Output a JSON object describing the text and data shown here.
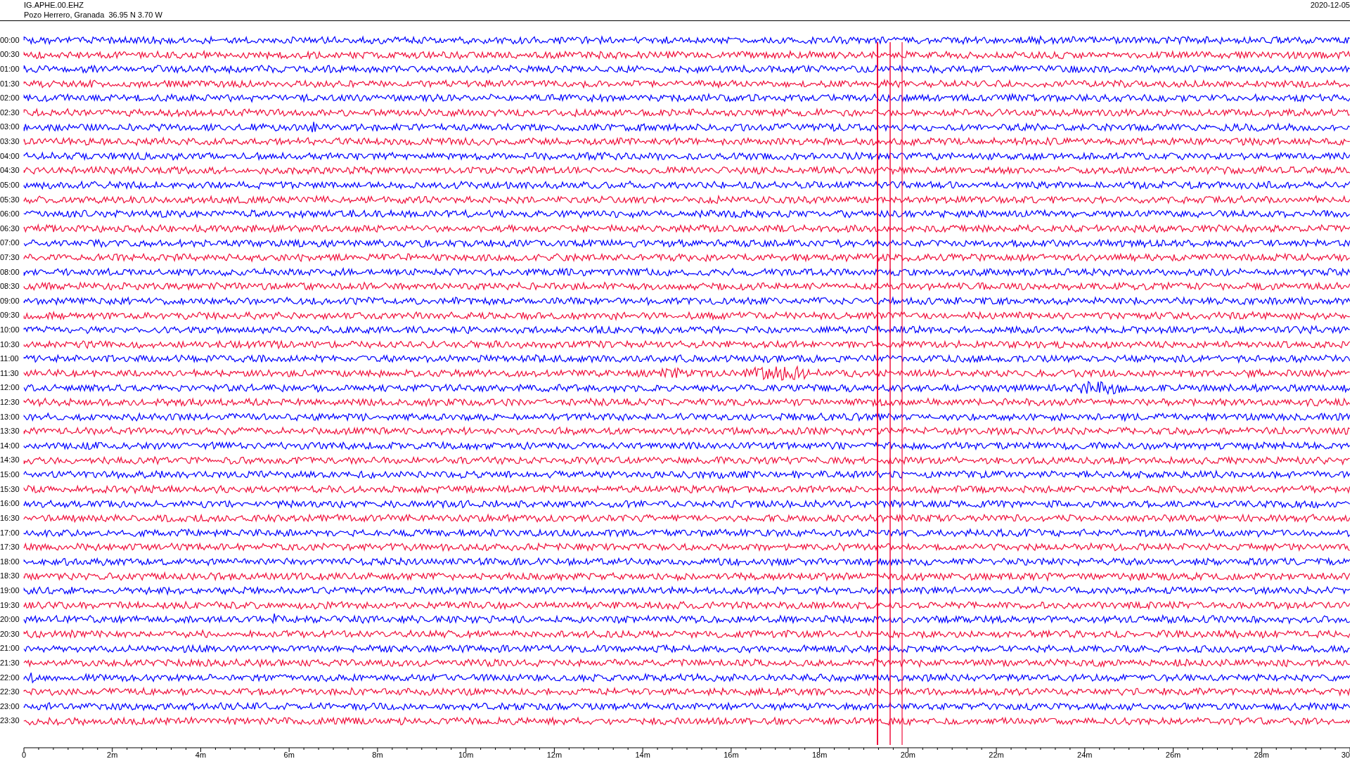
{
  "header": {
    "station": "IG.APHE.00.EHZ",
    "location": "Pozo Herrero, Granada  36.95 N 3.70 W",
    "date": "2020-12-05"
  },
  "traces": [
    {
      "label": "00:00",
      "color": "#0000ff"
    },
    {
      "label": "00:30",
      "color": "#f0103c"
    },
    {
      "label": "01:00",
      "color": "#0000ff"
    },
    {
      "label": "01:30",
      "color": "#f0103c"
    },
    {
      "label": "02:00",
      "color": "#0000ff"
    },
    {
      "label": "02:30",
      "color": "#f0103c"
    },
    {
      "label": "03:00",
      "color": "#0000ff"
    },
    {
      "label": "03:30",
      "color": "#f0103c"
    },
    {
      "label": "04:00",
      "color": "#0000ff"
    },
    {
      "label": "04:30",
      "color": "#f0103c"
    },
    {
      "label": "05:00",
      "color": "#0000ff"
    },
    {
      "label": "05:30",
      "color": "#f0103c"
    },
    {
      "label": "06:00",
      "color": "#0000ff"
    },
    {
      "label": "06:30",
      "color": "#f0103c"
    },
    {
      "label": "07:00",
      "color": "#0000ff"
    },
    {
      "label": "07:30",
      "color": "#f0103c"
    },
    {
      "label": "08:00",
      "color": "#0000ff"
    },
    {
      "label": "08:30",
      "color": "#f0103c"
    },
    {
      "label": "09:00",
      "color": "#0000ff"
    },
    {
      "label": "09:30",
      "color": "#f0103c"
    },
    {
      "label": "10:00",
      "color": "#0000ff"
    },
    {
      "label": "10:30",
      "color": "#f0103c"
    },
    {
      "label": "11:00",
      "color": "#0000ff"
    },
    {
      "label": "11:30",
      "color": "#f0103c"
    },
    {
      "label": "12:00",
      "color": "#0000ff"
    },
    {
      "label": "12:30",
      "color": "#f0103c"
    },
    {
      "label": "13:00",
      "color": "#0000ff"
    },
    {
      "label": "13:30",
      "color": "#f0103c"
    },
    {
      "label": "14:00",
      "color": "#0000ff"
    },
    {
      "label": "14:30",
      "color": "#f0103c"
    },
    {
      "label": "15:00",
      "color": "#0000ff"
    },
    {
      "label": "15:30",
      "color": "#f0103c"
    },
    {
      "label": "16:00",
      "color": "#0000ff"
    },
    {
      "label": "16:30",
      "color": "#f0103c"
    },
    {
      "label": "17:00",
      "color": "#0000ff"
    },
    {
      "label": "17:30",
      "color": "#f0103c"
    },
    {
      "label": "18:00",
      "color": "#0000ff"
    },
    {
      "label": "18:30",
      "color": "#f0103c"
    },
    {
      "label": "19:00",
      "color": "#0000ff"
    },
    {
      "label": "19:30",
      "color": "#f0103c"
    },
    {
      "label": "20:00",
      "color": "#0000ff"
    },
    {
      "label": "20:30",
      "color": "#f0103c"
    },
    {
      "label": "21:00",
      "color": "#0000ff"
    },
    {
      "label": "21:30",
      "color": "#f0103c"
    },
    {
      "label": "22:00",
      "color": "#0000ff"
    },
    {
      "label": "22:30",
      "color": "#f0103c"
    },
    {
      "label": "23:00",
      "color": "#0000ff"
    },
    {
      "label": "23:30",
      "color": "#f0103c"
    }
  ],
  "axis": {
    "labels": [
      "0",
      "2m",
      "4m",
      "6m",
      "8m",
      "10m",
      "12m",
      "14m",
      "16m",
      "18m",
      "20m",
      "22m",
      "24m",
      "26m",
      "28m",
      "30"
    ]
  }
}
